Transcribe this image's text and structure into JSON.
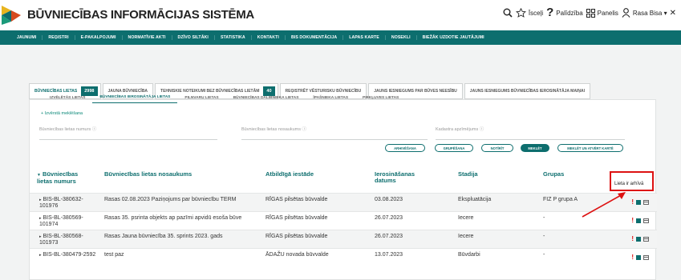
{
  "header": {
    "app_title": "BŪVNIECĪBAS INFORMĀCIJAS SISTĒMA",
    "icons": {
      "search": "search-icon",
      "star": "star-icon",
      "help": "help-icon",
      "panel": "grid-icon",
      "user": "user-icon"
    },
    "links": {
      "shortcuts": "Īsceļi",
      "help": "Palīdzība",
      "panel": "Panelis",
      "user": "Rasa Bisa ▾"
    }
  },
  "nav": {
    "items": [
      "JAUNUMI",
      "REĢISTRI",
      "E-PAKALPOJUMI",
      "NORMATĪVIE AKTI",
      "DZĪVO SILTĀKI",
      "STATISTIKA",
      "KONTAKTI",
      "BIS DOKUMENTĀCIJA",
      "LAPAS KARTE",
      "NOSEKLI",
      "BIEŽĀK UZDOTIE JAUTĀJUMI"
    ]
  },
  "tabs": [
    {
      "label": "BŪVNIECĪBAS LIETAS",
      "badge": "2998",
      "active": true
    },
    {
      "label": "JAUNA BŪVNIECĪBA",
      "badge": "",
      "active": false
    },
    {
      "label": "TEHNISKIE NOTEIKUMI BEZ BŪVNIECĪBAS LIETĀM",
      "badge": "40",
      "active": false
    },
    {
      "label": "REĢISTRĒT VĒSTURISKU BŪVNIECĪBU",
      "badge": "",
      "active": false
    },
    {
      "label": "JAUNS IESNIEGUMS PAR BŪVES NEESĪBU",
      "badge": "",
      "active": false
    },
    {
      "label": "JAUNS IESNIEGUMS BŪVNIECĪBAS IEROSINĀTĀJA MAIŅAI",
      "badge": "",
      "active": false
    }
  ],
  "subtabs": [
    {
      "label": "IZVĒLĒTĀS LIETAS",
      "active": false
    },
    {
      "label": "BŪVNIECĪBAS IEROSINĀTĀJA LIETAS",
      "active": true
    },
    {
      "label": "PILNVARU LIETAS",
      "active": false
    },
    {
      "label": "BŪVNIECĪBAS DALĪBNIEKA LIETAS",
      "active": false
    },
    {
      "label": "ĪPAŠNIEKA LIETAS",
      "active": false
    },
    {
      "label": "PIEKĻUVES LIETAS",
      "active": false
    }
  ],
  "search": {
    "advanced_link": "+ Izvērstā meklēšana",
    "case_number_label": "Būvniecības lietas numurs",
    "case_name_label": "Būvniecības lietas nosaukums",
    "cadastre_label": "Kadastra apzīmējums",
    "buttons": {
      "sort": "ARHIVĒŠANA",
      "group": "GRUPĒŠANA",
      "clear": "NOTĪRĪT",
      "search": "MEKLĒT",
      "search_map": "MEKLĒT UN ATVĒRT KARTĒ"
    }
  },
  "table": {
    "columns": [
      "Būvniecības lietas numurs",
      "Būvniecības lietas nosaukums",
      "Atbildīgā iestāde",
      "Ierosināšanas datums",
      "Stadija",
      "Grupas"
    ],
    "sort_marker": "▼",
    "archive_column_label": "Lieta ir arhīvā",
    "rows": [
      {
        "number": "BIS-BL-380632-101976",
        "name": "Rasas 02.08.2023 Paziņojums par būvniecību TERM",
        "authority": "RĪGAS pilsētas būvvalde",
        "date": "03.08.2023",
        "stage": "Ekspluatācija",
        "groups": "FIZ P grupa A"
      },
      {
        "number": "BIS-BL-380569-101974",
        "name": "Rasas 35. psrinta objekts ap pazīmi apvidū esoša būve",
        "authority": "RĪGAS pilsētas būvvalde",
        "date": "26.07.2023",
        "stage": "Iecere",
        "groups": "-"
      },
      {
        "number": "BIS-BL-380568-101973",
        "name": "Rasas Jauna būvniecība 35. sprints 2023. gads",
        "authority": "RĪGAS pilsētas būvvalde",
        "date": "26.07.2023",
        "stage": "Iecere",
        "groups": "-"
      },
      {
        "number": "BIS-BL-380479-2592",
        "name": "test paz",
        "authority": "ĀDAŽU novada būvvalde",
        "date": "13.07.2023",
        "stage": "Būvdarbi",
        "groups": "-"
      }
    ]
  },
  "colors": {
    "accent": "#0d6e6e",
    "highlight": "#dd1111"
  }
}
